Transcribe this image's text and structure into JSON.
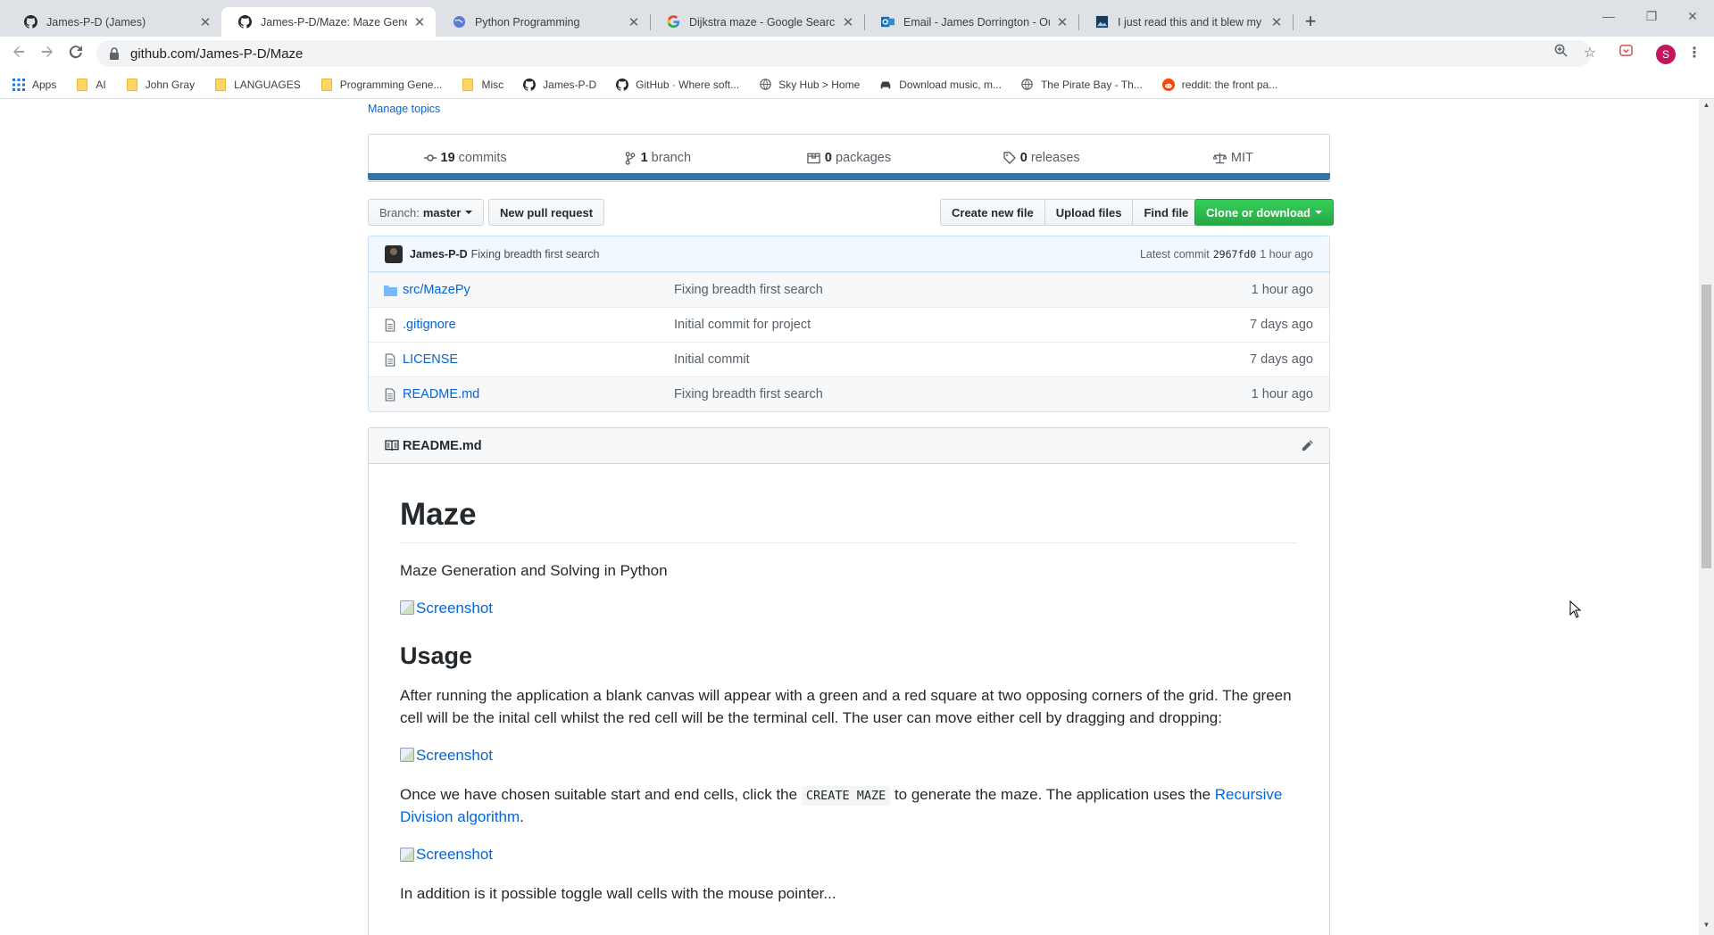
{
  "browser": {
    "tabs": [
      {
        "title": "James-P-D (James)",
        "icon": "github-icon",
        "active": false
      },
      {
        "title": "James-P-D/Maze: Maze Generati...",
        "icon": "github-icon",
        "active": true
      },
      {
        "title": "Python Programming",
        "icon": "globe-icon",
        "active": false
      },
      {
        "title": "Dijkstra maze - Google Search",
        "icon": "google-icon",
        "active": false
      },
      {
        "title": "Email - James Dorrington - Outlo...",
        "icon": "outlook-icon",
        "active": false
      },
      {
        "title": "I just read this and it blew my mi...",
        "icon": "image-icon",
        "active": false
      }
    ],
    "url": "github.com/James-P-D/Maze",
    "profile_initial": "S",
    "bookmarks": [
      {
        "label": "Apps",
        "icon": "apps-grid-icon"
      },
      {
        "label": "AI",
        "icon": "folder-icon"
      },
      {
        "label": "John Gray",
        "icon": "folder-icon"
      },
      {
        "label": "LANGUAGES",
        "icon": "folder-icon"
      },
      {
        "label": "Programming Gene...",
        "icon": "folder-icon"
      },
      {
        "label": "Misc",
        "icon": "folder-icon"
      },
      {
        "label": "James-P-D",
        "icon": "github-icon"
      },
      {
        "label": "GitHub · Where soft...",
        "icon": "github-icon"
      },
      {
        "label": "Sky Hub > Home",
        "icon": "globe-icon"
      },
      {
        "label": "Download music, m...",
        "icon": "car-icon"
      },
      {
        "label": "The Pirate Bay - Th...",
        "icon": "globe-icon"
      },
      {
        "label": "reddit: the front pa...",
        "icon": "reddit-icon"
      }
    ]
  },
  "repo": {
    "manage_topics": "Manage topics",
    "numbers": {
      "commits_count": "19",
      "commits_label": "commits",
      "branch_count": "1",
      "branch_label": "branch",
      "packages_count": "0",
      "packages_label": "packages",
      "releases_count": "0",
      "releases_label": "releases",
      "license": "MIT"
    },
    "language_color": "#3572A5",
    "buttons": {
      "branch_prefix": "Branch:",
      "branch_name": "master",
      "new_pull_request": "New pull request",
      "create_new_file": "Create new file",
      "upload_files": "Upload files",
      "find_file": "Find file",
      "clone_or_download": "Clone or download"
    },
    "latest_commit": {
      "author": "James-P-D",
      "message": "Fixing breadth first search",
      "label": "Latest commit",
      "sha": "2967fd0",
      "age": "1 hour ago"
    },
    "files": [
      {
        "type": "dir",
        "name": "src/MazePy",
        "message": "Fixing breadth first search",
        "age": "1 hour ago"
      },
      {
        "type": "file",
        "name": ".gitignore",
        "message": "Initial commit for project",
        "age": "7 days ago"
      },
      {
        "type": "file",
        "name": "LICENSE",
        "message": "Initial commit",
        "age": "7 days ago"
      },
      {
        "type": "file",
        "name": "README.md",
        "message": "Fixing breadth first search",
        "age": "1 hour ago"
      }
    ]
  },
  "readme": {
    "filename": "README.md",
    "title": "Maze",
    "subtitle": "Maze Generation and Solving in Python",
    "img_alt": "Screenshot",
    "usage_heading": "Usage",
    "usage_p1": "After running the application a blank canvas will appear with a green and a red square at two opposing corners of the grid. The green cell will be the inital cell whilst the red cell will be the terminal cell. The user can move either cell by dragging and dropping:",
    "usage_p2_before": "Once we have chosen suitable start and end cells, click the ",
    "usage_p2_code": "CREATE MAZE",
    "usage_p2_after": " to generate the maze. The application uses the ",
    "usage_p2_link": "Recursive Division algorithm",
    "usage_p2_end": ".",
    "usage_p3": "In addition is it possible toggle wall cells with the mouse pointer..."
  }
}
